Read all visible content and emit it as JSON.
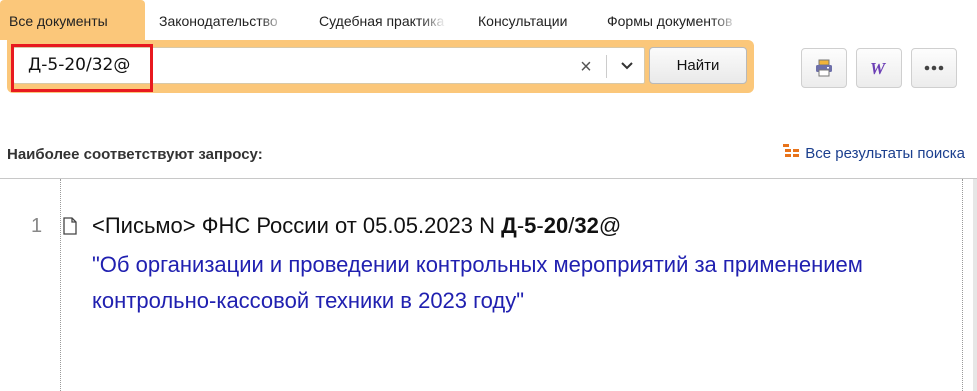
{
  "tabs": [
    {
      "label": "Все документы",
      "active": true
    },
    {
      "label": "Законодательство",
      "active": false
    },
    {
      "label": "Судебная практика",
      "active": false
    },
    {
      "label": "Консультации",
      "active": false
    },
    {
      "label": "Формы документов",
      "active": false
    }
  ],
  "search": {
    "value": "Д-5-20/32@",
    "clear_icon": "close-icon",
    "dropdown_icon": "chevron-down-icon",
    "find_label": "Найти"
  },
  "toolbar": {
    "print_icon": "printer-icon",
    "word_icon": "word-export-icon",
    "more_icon": "more-icon"
  },
  "results_header": {
    "title": "Наиболее соответствуют запросу:",
    "all_results_label": "Все результаты поиска"
  },
  "results": [
    {
      "number": "1",
      "title_prefix": "<Письмо> ФНС России от 05.05.2023 N ",
      "title_code": [
        "Д",
        "-",
        "5",
        "-",
        "20",
        "/",
        "32",
        "@"
      ],
      "description": "\"Об организации и проведении контрольных мероприятий за применением контрольно-кассовой техники в 2023 году\""
    }
  ],
  "colors": {
    "accent": "#fbc77a",
    "link": "#2020b0",
    "highlight": "#e8191f"
  }
}
